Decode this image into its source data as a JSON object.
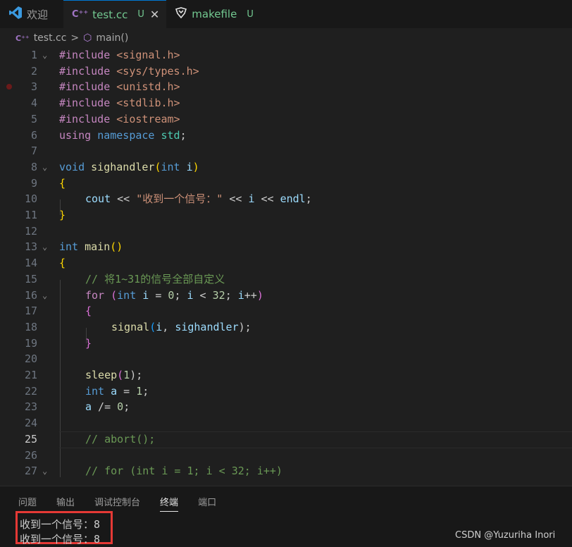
{
  "tabs": [
    {
      "label": "欢迎",
      "icon": "vscode-icon"
    },
    {
      "label": "test.cc",
      "status": "U",
      "icon": "cpp-icon"
    },
    {
      "label": "makefile",
      "status": "U",
      "icon": "makefile-icon"
    }
  ],
  "breadcrumb": {
    "file": "test.cc",
    "sep": ">",
    "symbol": "main()"
  },
  "line_numbers": [
    "1",
    "2",
    "3",
    "4",
    "5",
    "6",
    "7",
    "8",
    "9",
    "10",
    "11",
    "12",
    "13",
    "14",
    "15",
    "16",
    "17",
    "18",
    "19",
    "20",
    "21",
    "22",
    "23",
    "24",
    "25",
    "26",
    "27"
  ],
  "code": {
    "l1": [
      "#include ",
      "<signal.h>"
    ],
    "l2": [
      "#include ",
      "<sys/types.h>"
    ],
    "l3": [
      "#include ",
      "<unistd.h>"
    ],
    "l4": [
      "#include ",
      "<stdlib.h>"
    ],
    "l5": [
      "#include ",
      "<iostream>"
    ],
    "l6": [
      "using ",
      "namespace ",
      "std",
      ";"
    ],
    "l8": [
      "void ",
      "sighandler",
      "(",
      "int ",
      "i",
      ")"
    ],
    "l9": "{",
    "l10": [
      "cout ",
      "<< ",
      "\"收到一个信号：\"",
      " << ",
      "i",
      " << ",
      "endl",
      ";"
    ],
    "l11": "}",
    "l13": [
      "int ",
      "main",
      "()"
    ],
    "l14": "{",
    "l15": "// 将1~31的信号全部自定义",
    "l16": [
      "for ",
      "(",
      "int ",
      "i",
      " = ",
      "0",
      "; ",
      "i",
      " < ",
      "32",
      "; ",
      "i",
      "++",
      ")"
    ],
    "l17": "{",
    "l18": [
      "signal",
      "(",
      "i",
      ", ",
      "sighandler",
      ");"
    ],
    "l19": "}",
    "l21": [
      "sleep",
      "(",
      "1",
      ");"
    ],
    "l22": [
      "int ",
      "a",
      " = ",
      "1",
      ";"
    ],
    "l23": [
      "a",
      " /= ",
      "0",
      ";"
    ],
    "l25": "// abort();",
    "l27": "// for (int i = 1; i < 32; i++)"
  },
  "panel_tabs": [
    "问题",
    "输出",
    "调试控制台",
    "终端",
    "端口"
  ],
  "terminal": [
    "收到一个信号：8",
    "收到一个信号：8"
  ],
  "watermark": "CSDN @Yuzuriha  Inori"
}
